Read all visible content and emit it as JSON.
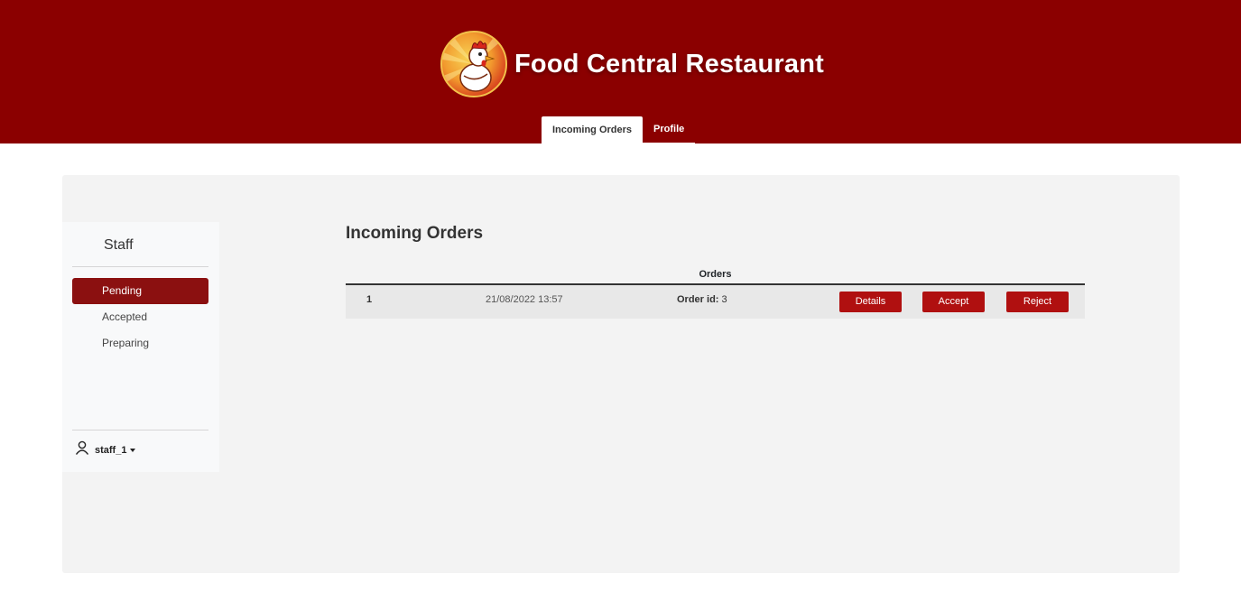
{
  "app": {
    "title": "Food Central Restaurant",
    "logo": "chicken-mascot-logo"
  },
  "nav": {
    "tabs": [
      {
        "label": "Incoming Orders",
        "active": true
      },
      {
        "label": "Profile",
        "active": false
      }
    ]
  },
  "sidebar": {
    "title": "Staff",
    "items": [
      {
        "label": "Pending",
        "active": true
      },
      {
        "label": "Accepted",
        "active": false
      },
      {
        "label": "Preparing",
        "active": false
      }
    ],
    "user": {
      "icon": "user-icon",
      "name": "staff_1"
    }
  },
  "main": {
    "title": "Incoming Orders",
    "table": {
      "header": "Orders",
      "rows": [
        {
          "index": "1",
          "datetime": "21/08/2022 13:57",
          "order_label": "Order id:",
          "order_id": "3",
          "actions": [
            "Details",
            "Accept",
            "Reject"
          ]
        }
      ]
    }
  },
  "colors": {
    "header_bg": "#8b0000",
    "active_item_bg": "#8b1010",
    "button_bg": "#b01010",
    "panel_bg": "#f3f3f3"
  }
}
